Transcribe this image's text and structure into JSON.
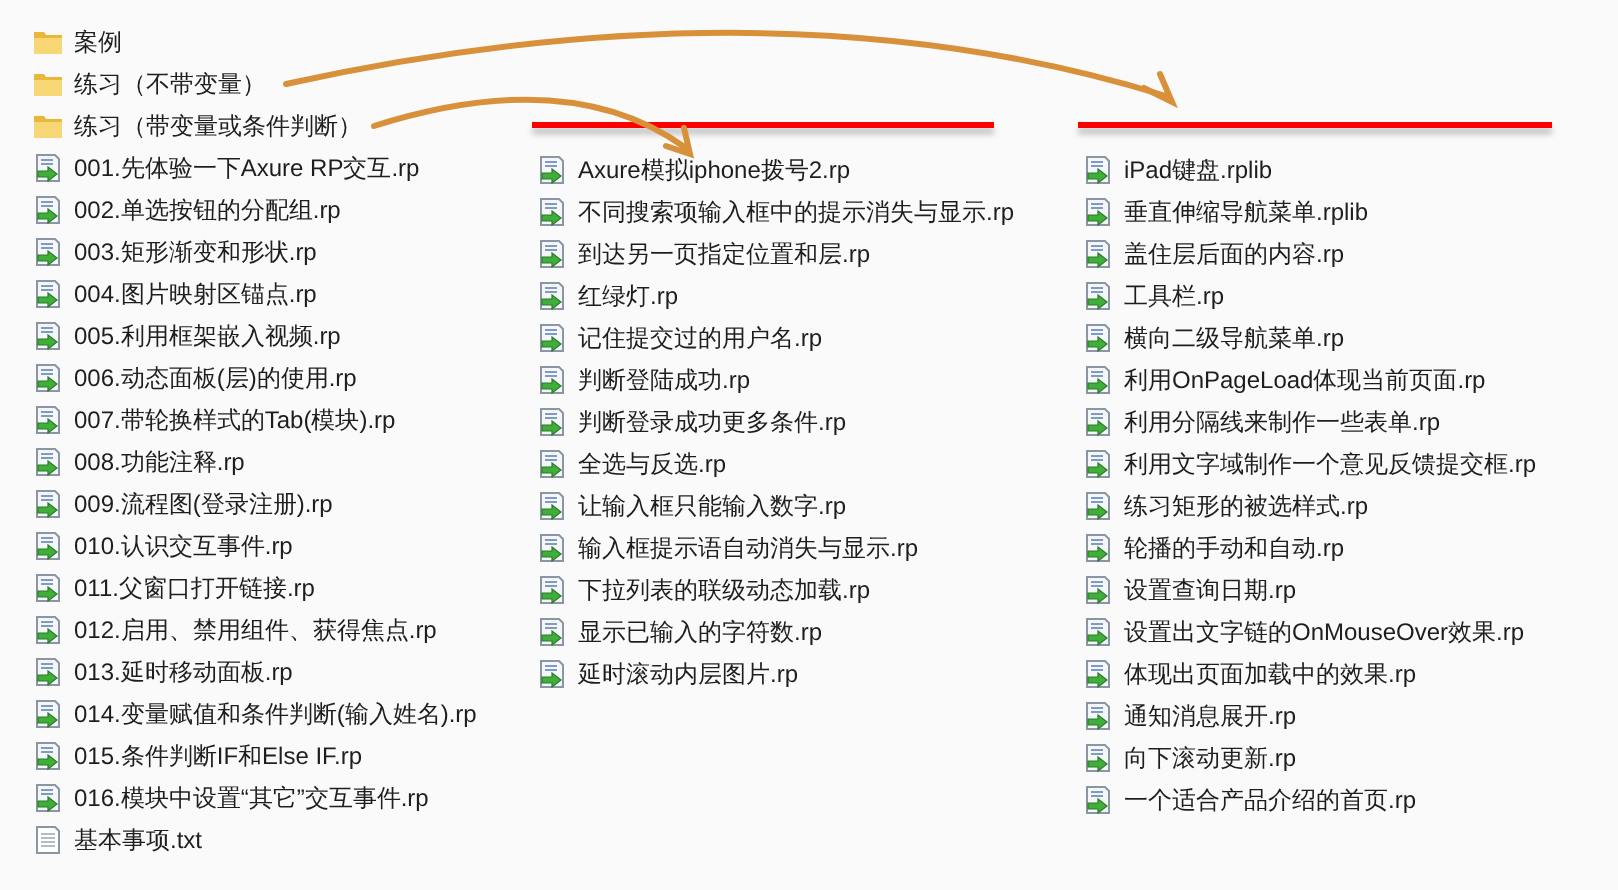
{
  "columns": [
    {
      "underline": false,
      "items": [
        {
          "kind": "folder",
          "name": "案例"
        },
        {
          "kind": "folder",
          "name": "练习（不带变量）"
        },
        {
          "kind": "folder",
          "name": "练习（带变量或条件判断）"
        },
        {
          "kind": "rp",
          "name": "001.先体验一下Axure RP交互.rp"
        },
        {
          "kind": "rp",
          "name": "002.单选按钮的分配组.rp"
        },
        {
          "kind": "rp",
          "name": "003.矩形渐变和形状.rp"
        },
        {
          "kind": "rp",
          "name": "004.图片映射区锚点.rp"
        },
        {
          "kind": "rp",
          "name": "005.利用框架嵌入视频.rp"
        },
        {
          "kind": "rp",
          "name": "006.动态面板(层)的使用.rp"
        },
        {
          "kind": "rp",
          "name": "007.带轮换样式的Tab(模块).rp"
        },
        {
          "kind": "rp",
          "name": "008.功能注释.rp"
        },
        {
          "kind": "rp",
          "name": "009.流程图(登录注册).rp"
        },
        {
          "kind": "rp",
          "name": "010.认识交互事件.rp"
        },
        {
          "kind": "rp",
          "name": "011.父窗口打开链接.rp"
        },
        {
          "kind": "rp",
          "name": "012.启用、禁用组件、获得焦点.rp"
        },
        {
          "kind": "rp",
          "name": "013.延时移动面板.rp"
        },
        {
          "kind": "rp",
          "name": "014.变量赋值和条件判断(输入姓名).rp"
        },
        {
          "kind": "rp",
          "name": "015.条件判断IF和Else IF.rp"
        },
        {
          "kind": "rp",
          "name": "016.模块中设置“其它”交互事件.rp"
        },
        {
          "kind": "txt",
          "name": "基本事项.txt"
        }
      ]
    },
    {
      "underline": true,
      "items": [
        {
          "kind": "rp",
          "name": "Axure模拟iphone拨号2.rp"
        },
        {
          "kind": "rp",
          "name": "不同搜索项输入框中的提示消失与显示.rp"
        },
        {
          "kind": "rp",
          "name": "到达另一页指定位置和层.rp"
        },
        {
          "kind": "rp",
          "name": "红绿灯.rp"
        },
        {
          "kind": "rp",
          "name": "记住提交过的用户名.rp"
        },
        {
          "kind": "rp",
          "name": "判断登陆成功.rp"
        },
        {
          "kind": "rp",
          "name": "判断登录成功更多条件.rp"
        },
        {
          "kind": "rp",
          "name": "全选与反选.rp"
        },
        {
          "kind": "rp",
          "name": "让输入框只能输入数字.rp"
        },
        {
          "kind": "rp",
          "name": "输入框提示语自动消失与显示.rp"
        },
        {
          "kind": "rp",
          "name": "下拉列表的联级动态加载.rp"
        },
        {
          "kind": "rp",
          "name": "显示已输入的字符数.rp"
        },
        {
          "kind": "rp",
          "name": "延时滚动内层图片.rp"
        }
      ]
    },
    {
      "underline": true,
      "items": [
        {
          "kind": "rp",
          "name": "iPad键盘.rplib"
        },
        {
          "kind": "rp",
          "name": "垂直伸缩导航菜单.rplib"
        },
        {
          "kind": "rp",
          "name": "盖住层后面的内容.rp"
        },
        {
          "kind": "rp",
          "name": "工具栏.rp"
        },
        {
          "kind": "rp",
          "name": "横向二级导航菜单.rp"
        },
        {
          "kind": "rp",
          "name": "利用OnPageLoad体现当前页面.rp"
        },
        {
          "kind": "rp",
          "name": "利用分隔线来制作一些表单.rp"
        },
        {
          "kind": "rp",
          "name": "利用文字域制作一个意见反馈提交框.rp"
        },
        {
          "kind": "rp",
          "name": "练习矩形的被选样式.rp"
        },
        {
          "kind": "rp",
          "name": "轮播的手动和自动.rp"
        },
        {
          "kind": "rp",
          "name": "设置查询日期.rp"
        },
        {
          "kind": "rp",
          "name": "设置出文字链的OnMouseOver效果.rp"
        },
        {
          "kind": "rp",
          "name": "体现出页面加载中的效果.rp"
        },
        {
          "kind": "rp",
          "name": "通知消息展开.rp"
        },
        {
          "kind": "rp",
          "name": "向下滚动更新.rp"
        },
        {
          "kind": "rp",
          "name": "一个适合产品介绍的首页.rp"
        }
      ]
    }
  ]
}
